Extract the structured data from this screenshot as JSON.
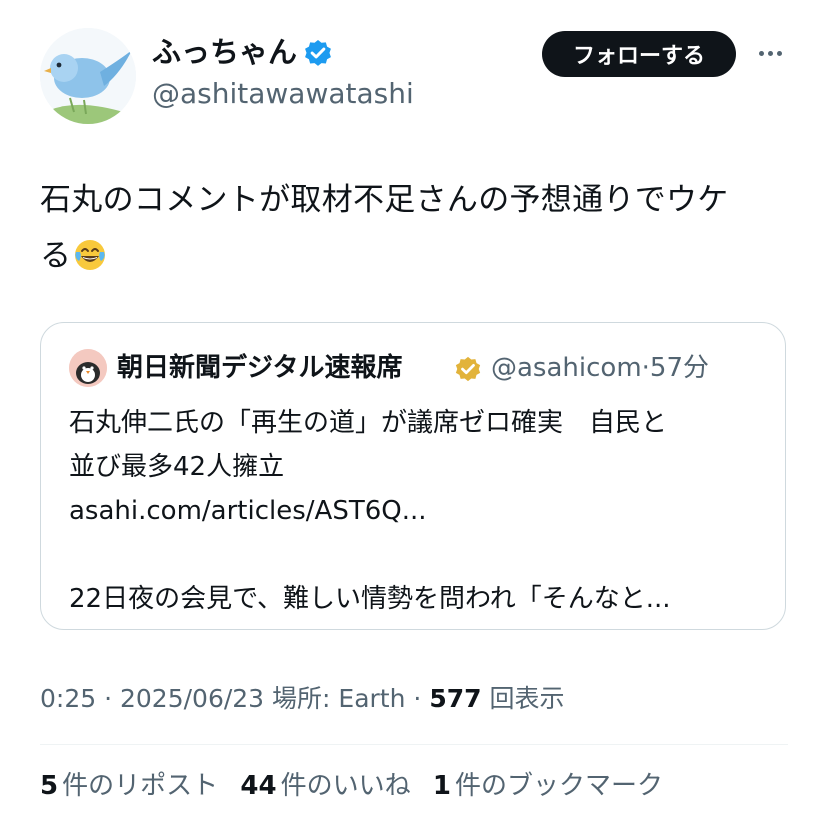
{
  "author": {
    "display_name": "ふっちゃん",
    "handle": "@ashitawawatashi",
    "verified": true,
    "badge_color": "#1d9bf0"
  },
  "actions": {
    "follow_label": "フォローする",
    "more_icon": "ellipsis-icon"
  },
  "tweet": {
    "text_line1": "石丸のコメントが取材不足さんの予想通りでウケ",
    "text_line2": "る",
    "emoji": "face-with-tears-of-joy"
  },
  "quote": {
    "display_name": "朝日新聞デジタル速報席",
    "handle": "@asahicom",
    "separator": "·",
    "time": "57分",
    "badge_color": "#d4a72c",
    "text_line1": "石丸伸二氏の「再生の道」が議席ゼロ確実　自民と",
    "text_line2": "並び最多42人擁立",
    "link": "asahi.com/articles/AST6Q...",
    "text_line3": "22日夜の会見で、難しい情勢を問われ「そんなと..."
  },
  "meta": {
    "time": "0:25",
    "date": "2025/06/23",
    "location": "場所: Earth",
    "views_count": "577",
    "views_label": "回表示",
    "separator": "·"
  },
  "stats": {
    "reposts_count": "5",
    "reposts_label": "件のリポスト",
    "likes_count": "44",
    "likes_label": "件のいいね",
    "bookmarks_count": "1",
    "bookmarks_label": "件のブックマーク"
  },
  "colors": {
    "text_primary": "#0f1419",
    "text_secondary": "#536471",
    "border": "#cfd9de",
    "follow_bg": "#0f1419"
  }
}
